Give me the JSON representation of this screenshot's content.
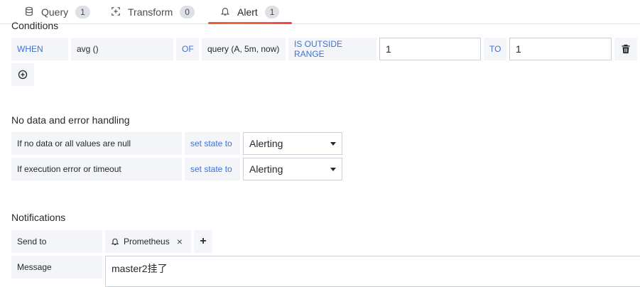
{
  "tabs": [
    {
      "label": "Query",
      "count": "1",
      "icon": "database-icon"
    },
    {
      "label": "Transform",
      "count": "0",
      "icon": "transform-icon"
    },
    {
      "label": "Alert",
      "count": "1",
      "icon": "bell-icon"
    }
  ],
  "conditions": {
    "title": "Conditions",
    "when": "WHEN",
    "reducer": "avg ()",
    "of": "OF",
    "query": "query (A, 5m, now)",
    "evaluator": "IS OUTSIDE RANGE",
    "from_value": "1",
    "to": "TO",
    "to_value": "1"
  },
  "no_data": {
    "title": "No data and error handling",
    "rows": [
      {
        "label": "If no data or all values are null",
        "action": "set state to",
        "value": "Alerting"
      },
      {
        "label": "If execution error or timeout",
        "action": "set state to",
        "value": "Alerting"
      }
    ]
  },
  "notifications": {
    "title": "Notifications",
    "send_to_label": "Send to",
    "channel": "Prometheus",
    "remove_symbol": "×",
    "add_symbol": "+",
    "message_label": "Message",
    "message_value": "master2挂了"
  },
  "colors": {
    "keyword": "#3d71d9",
    "label_bg": "#f4f5f8",
    "accent": "#f53e4c"
  }
}
